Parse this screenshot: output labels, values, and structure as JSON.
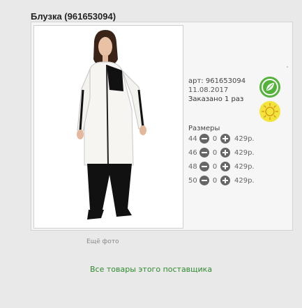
{
  "product": {
    "title": "Блузка (961653094)",
    "article": "арт: 961653094",
    "date": "11.08.2017",
    "ordered": "Заказано 1 раз"
  },
  "badges": {
    "eco_icon": "leaf-icon",
    "eco_color": "#55b33b",
    "sun_icon": "sun-icon",
    "sun_color": "#f2e43a"
  },
  "sizes": {
    "title": "Размеры",
    "rows": [
      {
        "size": "44",
        "qty": "0",
        "price": "429р."
      },
      {
        "size": "46",
        "qty": "0",
        "price": "429р."
      },
      {
        "size": "48",
        "qty": "0",
        "price": "429р."
      },
      {
        "size": "50",
        "qty": "0",
        "price": "429р."
      }
    ]
  },
  "links": {
    "more_photo": "Ещё фото",
    "all_supplier_goods": "Все товары этого поставщика"
  },
  "colors": {
    "link": "#2e8b2e",
    "background": "#e9e9e9"
  }
}
